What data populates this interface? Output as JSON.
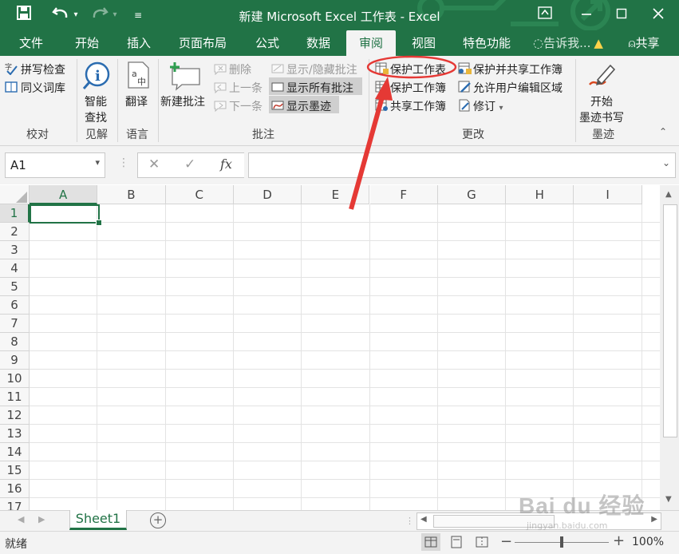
{
  "window": {
    "title": "新建 Microsoft Excel 工作表 - Excel",
    "colors": {
      "brand": "#217346",
      "ribbon_bg": "#f3f3f3",
      "annotation": "#e53935"
    }
  },
  "quick_access": {
    "icons": [
      "save-icon",
      "undo-icon",
      "redo-icon",
      "customize-icon"
    ]
  },
  "window_controls": {
    "icons": [
      "ribbon-display-icon",
      "minimize-icon",
      "restore-icon",
      "close-icon"
    ]
  },
  "tabs": [
    {
      "label": "文件"
    },
    {
      "label": "开始"
    },
    {
      "label": "插入"
    },
    {
      "label": "页面布局"
    },
    {
      "label": "公式"
    },
    {
      "label": "数据"
    },
    {
      "label": "审阅",
      "active": true
    },
    {
      "label": "视图"
    },
    {
      "label": "特色功能"
    }
  ],
  "tell_me": "告诉我...",
  "share": "共享",
  "ribbon": {
    "proofing": {
      "spell": "拼写检查",
      "thesaurus": "同义词库",
      "label": "校对"
    },
    "insights": {
      "smart_line1": "智能",
      "smart_line2": "查找",
      "label": "见解"
    },
    "language": {
      "translate": "翻译",
      "label": "语言"
    },
    "comments": {
      "new": "新建批注",
      "delete": "删除",
      "previous": "上一条",
      "next": "下一条",
      "show_hide": "显示/隐藏批注",
      "show_all": "显示所有批注",
      "show_ink": "显示墨迹",
      "label": "批注"
    },
    "changes": {
      "protect_sheet": "保护工作表",
      "protect_workbook": "保护工作簿",
      "share_workbook": "共享工作簿",
      "protect_share": "保护并共享工作簿",
      "allow_edit": "允许用户编辑区域",
      "track": "修订",
      "label": "更改"
    },
    "ink": {
      "start_line1": "开始",
      "start_line2": "墨迹书写",
      "label": "墨迹"
    }
  },
  "formula_bar": {
    "name_box": "A1",
    "fx": "fx",
    "value": ""
  },
  "grid": {
    "columns": [
      "A",
      "B",
      "C",
      "D",
      "E",
      "F",
      "G",
      "H",
      "I"
    ],
    "rows": [
      "1",
      "2",
      "3",
      "4",
      "5",
      "6",
      "7",
      "8",
      "9",
      "10",
      "11",
      "12",
      "13",
      "14",
      "15",
      "16",
      "17"
    ],
    "selected_cell": "A1"
  },
  "sheets": [
    {
      "name": "Sheet1",
      "active": true
    }
  ],
  "status": {
    "mode": "就绪",
    "zoom": "100%"
  },
  "watermark": {
    "brand": "Bai du 经验",
    "url": "jingyan.baidu.com"
  }
}
